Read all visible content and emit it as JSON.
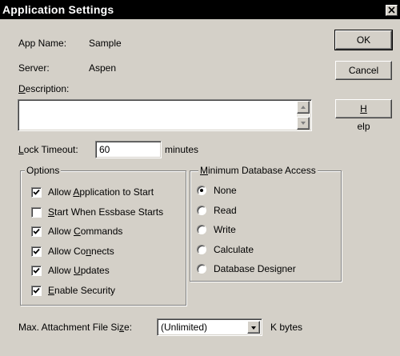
{
  "window": {
    "title": "Application Settings",
    "close_icon": "close-icon"
  },
  "info": {
    "app_name_label": "App Name:",
    "app_name_value": "Sample",
    "server_label": "Server:",
    "server_value": "Aspen",
    "description_label": "Description:",
    "description_value": ""
  },
  "buttons": {
    "ok": "OK",
    "cancel": "Cancel",
    "help": "Help"
  },
  "lock_timeout": {
    "label": "Lock Timeout:",
    "value": "60",
    "unit": "minutes"
  },
  "options": {
    "legend": "Options",
    "items": [
      {
        "label": "Allow Application to Start",
        "checked": true
      },
      {
        "label": "Start When Essbase Starts",
        "checked": false
      },
      {
        "label": "Allow Commands",
        "checked": true
      },
      {
        "label": "Allow Connects",
        "checked": true
      },
      {
        "label": "Allow Updates",
        "checked": true
      },
      {
        "label": "Enable Security",
        "checked": true
      }
    ]
  },
  "min_access": {
    "legend": "Minimum Database Access",
    "selected": "None",
    "items": [
      "None",
      "Read",
      "Write",
      "Calculate",
      "Database Designer"
    ]
  },
  "attachment": {
    "label": "Max. Attachment File Size:",
    "value": "(Unlimited)",
    "unit": "K bytes"
  },
  "colors": {
    "face": "#d4d0c8",
    "titlebar": "#000000",
    "titletext": "#ffffff"
  }
}
